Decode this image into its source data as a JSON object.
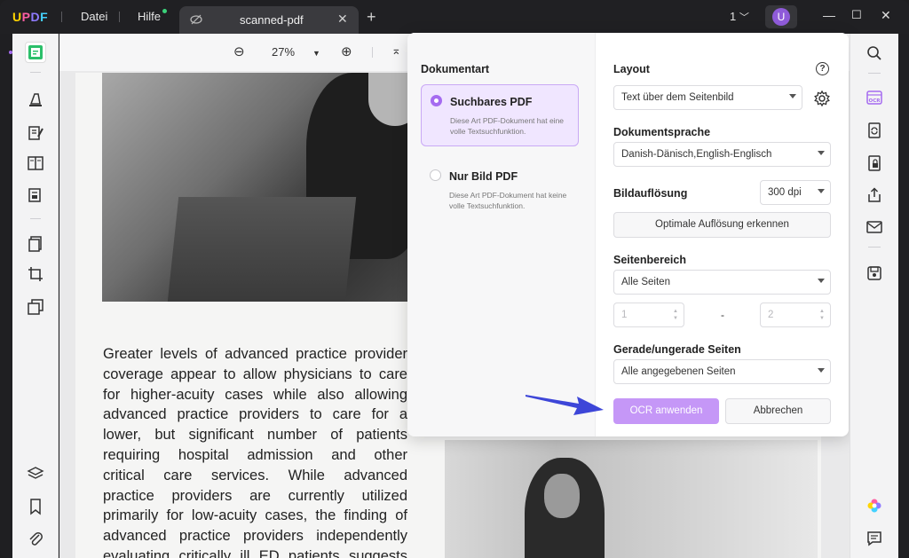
{
  "app": {
    "logo": "UPDF",
    "menu": [
      "Datei",
      "Hilfe"
    ],
    "tab_title": "scanned-pdf",
    "page_selector": "1",
    "avatar_letter": "U"
  },
  "zoom": {
    "value": "27%"
  },
  "document": {
    "lines": [
      "Greater levels of advanced practice provider",
      "coverage appear to allow physicians to care",
      "for higher-acuity cases while also allowing",
      "advanced practice providers to care for a",
      "lower, but significant number of patients",
      "requiring hospital admission and other",
      "critical care services. While advanced",
      "practice providers are currently utilized",
      "primarily for low-acuity cases, the finding of",
      "advanced practice providers independently",
      "evaluating critically ill ED patients suggests"
    ]
  },
  "ocr": {
    "doc_type_title": "Dokumentart",
    "options": [
      {
        "name": "Suchbares PDF",
        "desc": "Diese Art PDF-Dokument hat eine volle Textsuchfunktion.",
        "selected": true
      },
      {
        "name": "Nur Bild PDF",
        "desc": "Diese Art PDF-Dokument hat keine volle Textsuchfunktion.",
        "selected": false
      }
    ],
    "layout_title": "Layout",
    "layout_value": "Text über dem Seitenbild",
    "lang_title": "Dokumentsprache",
    "lang_value": "Danish-Dänisch,English-Englisch",
    "res_title": "Bildauflösung",
    "res_value": "300 dpi",
    "detect_btn": "Optimale Auflösung erkennen",
    "range_title": "Seitenbereich",
    "range_value": "Alle Seiten",
    "range_from": "1",
    "range_to": "2",
    "range_dash": "-",
    "oddeven_title": "Gerade/ungerade Seiten",
    "oddeven_value": "Alle angegebenen Seiten",
    "apply_btn": "OCR anwenden",
    "cancel_btn": "Abbrechen"
  },
  "colors": {
    "accent": "#a56bf0",
    "primary_button": "#c597f7",
    "arrow": "#3d46d8"
  }
}
